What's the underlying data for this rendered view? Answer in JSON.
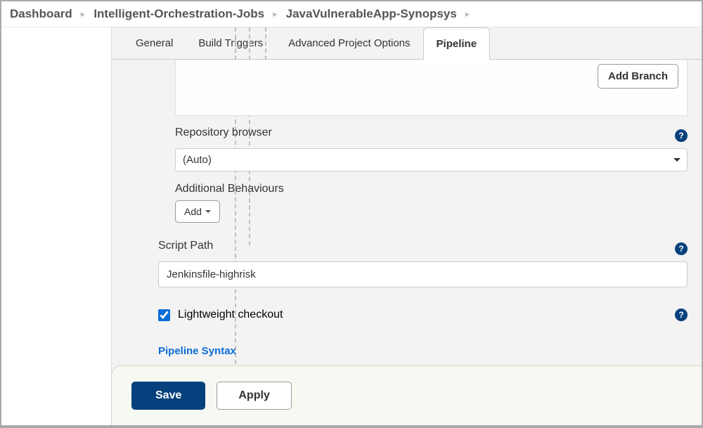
{
  "breadcrumb": {
    "items": [
      "Dashboard",
      "Intelligent-Orchestration-Jobs",
      "JavaVulnerableApp-Synopsys"
    ]
  },
  "tabs": {
    "items": [
      {
        "label": "General",
        "active": false
      },
      {
        "label": "Build Triggers",
        "active": false
      },
      {
        "label": "Advanced Project Options",
        "active": false
      },
      {
        "label": "Pipeline",
        "active": true
      }
    ]
  },
  "buttons": {
    "add_branch": "Add Branch",
    "add": "Add",
    "save": "Save",
    "apply": "Apply"
  },
  "sections": {
    "repository_browser": {
      "label": "Repository browser",
      "value": "(Auto)"
    },
    "additional_behaviours": {
      "label": "Additional Behaviours"
    },
    "script_path": {
      "label": "Script Path",
      "value": "Jenkinsfile-highrisk"
    },
    "lightweight_checkout": {
      "label": "Lightweight checkout",
      "checked": true
    }
  },
  "links": {
    "pipeline_syntax": "Pipeline Syntax"
  }
}
